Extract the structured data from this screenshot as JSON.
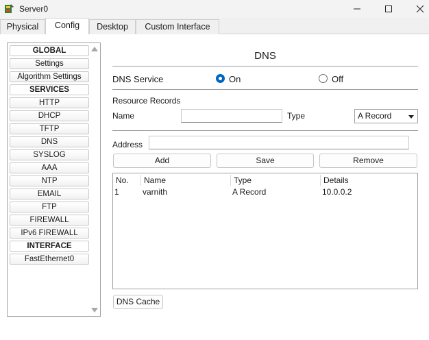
{
  "window": {
    "title": "Server0",
    "minimize_glyph": "—",
    "maximize_glyph": "☐",
    "close_glyph": "✕"
  },
  "tabs": [
    {
      "label": "Physical",
      "active": false
    },
    {
      "label": "Config",
      "active": true
    },
    {
      "label": "Desktop",
      "active": false
    },
    {
      "label": "Custom Interface",
      "active": false
    }
  ],
  "sidebar": {
    "items": [
      {
        "label": "GLOBAL",
        "header": true
      },
      {
        "label": "Settings"
      },
      {
        "label": "Algorithm Settings"
      },
      {
        "label": "SERVICES",
        "header": true
      },
      {
        "label": "HTTP"
      },
      {
        "label": "DHCP"
      },
      {
        "label": "TFTP"
      },
      {
        "label": "DNS"
      },
      {
        "label": "SYSLOG"
      },
      {
        "label": "AAA"
      },
      {
        "label": "NTP"
      },
      {
        "label": "EMAIL"
      },
      {
        "label": "FTP"
      },
      {
        "label": "FIREWALL"
      },
      {
        "label": "IPv6 FIREWALL"
      },
      {
        "label": "INTERFACE",
        "header": true
      },
      {
        "label": "FastEthernet0"
      }
    ]
  },
  "dns": {
    "title": "DNS",
    "service_label": "DNS Service",
    "on_label": "On",
    "off_label": "Off",
    "service_state": "On",
    "resource_records_label": "Resource Records",
    "name_label": "Name",
    "name_value": "",
    "type_label": "Type",
    "type_value": "A Record",
    "address_label": "Address",
    "address_value": "",
    "add_label": "Add",
    "save_label": "Save",
    "remove_label": "Remove",
    "columns": [
      "No.",
      "Name",
      "Type",
      "Details"
    ],
    "rows": [
      {
        "no": "1",
        "name": "varnith",
        "type": "A Record",
        "details": "10.0.0.2"
      }
    ],
    "cache_label": "DNS Cache"
  },
  "colors": {
    "accent": "#0067c0"
  }
}
